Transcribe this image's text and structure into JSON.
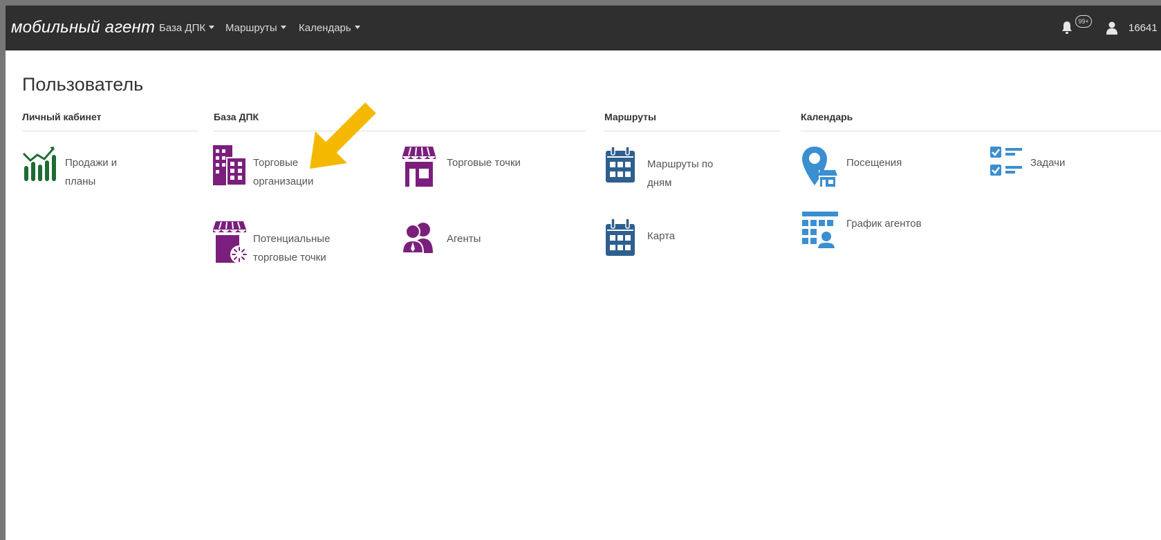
{
  "navbar": {
    "brand": "мобильный агент",
    "menu": [
      {
        "label": "База ДПК"
      },
      {
        "label": "Маршруты"
      },
      {
        "label": "Календарь"
      }
    ],
    "notifications_badge": "99+",
    "user_id": "16641"
  },
  "page": {
    "title": "Пользователь"
  },
  "sections": {
    "cabinet": {
      "title": "Личный кабинет"
    },
    "dpk": {
      "title": "База ДПК"
    },
    "routes": {
      "title": "Маршруты"
    },
    "calendar": {
      "title": "Календарь"
    }
  },
  "tiles": {
    "sales": {
      "line1": "Продажи и",
      "line2": "планы",
      "icon": "sales-chart-icon"
    },
    "trade_orgs": {
      "line1": "Торговые",
      "line2": "организации",
      "icon": "buildings-icon"
    },
    "trade_points": {
      "line1": "Торговые точки",
      "icon": "storefront-icon"
    },
    "potential_points": {
      "line1": "Потенциальные",
      "line2": "торговые точки",
      "icon": "potential-store-icon"
    },
    "agents": {
      "line1": "Агенты",
      "icon": "agents-icon"
    },
    "routes_by_days": {
      "line1": "Маршруты по",
      "line2": "дням",
      "icon": "calendar-icon"
    },
    "map": {
      "line1": "Карта",
      "icon": "calendar-map-icon"
    },
    "visits": {
      "line1": "Посещения",
      "icon": "map-pin-store-icon"
    },
    "agent_schedule": {
      "line1": "График агентов",
      "icon": "schedule-icon"
    },
    "tasks": {
      "line1": "Задачи",
      "icon": "checklist-icon"
    }
  },
  "colors": {
    "navbar": "#2f2f2f",
    "green": "#1e6b33",
    "purple": "#7b1f7d",
    "navy": "#2e5f8f",
    "blue": "#3a8fd1",
    "arrow": "#f5b800"
  }
}
